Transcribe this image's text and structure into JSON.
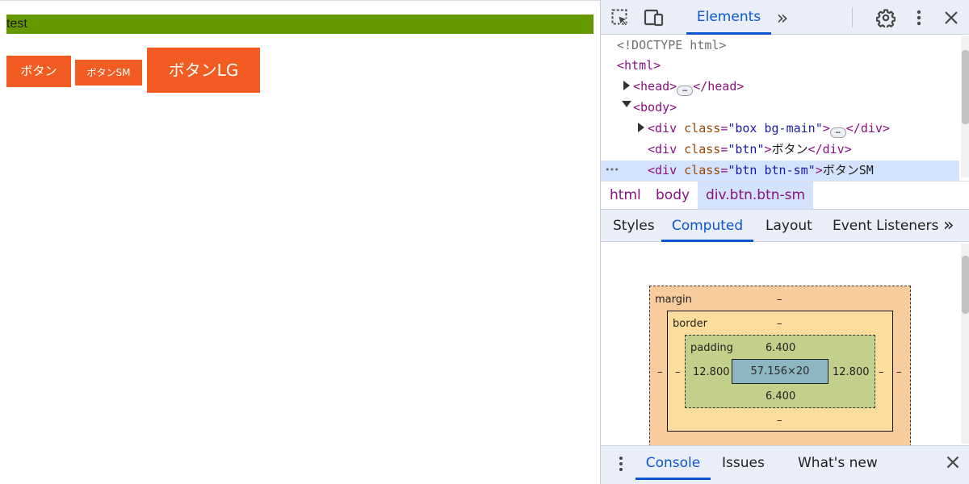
{
  "page": {
    "box_text": "test",
    "buttons": [
      "ボタン",
      "ボタンSM",
      "ボタンLG"
    ],
    "colors": {
      "box": "#669900",
      "button": "#f25c22"
    }
  },
  "devtools": {
    "toolbar": {
      "icons": [
        "inspect-element-icon",
        "device-toolbar-icon",
        "more-tabs-chevron-icon",
        "settings-gear-icon",
        "more-options-kebab-icon",
        "close-icon"
      ],
      "active_tab": "Elements",
      "more_tabs": "»"
    },
    "dom": {
      "doctype": "<!DOCTYPE html>",
      "html_open": "<html>",
      "head_open": "<head>",
      "head_close": "</head>",
      "body_open": "<body>",
      "div_open": "<div",
      "div_close_tag": "</div>",
      "gt": ">",
      "class_attr": "class",
      "eq": "=",
      "box_class": "\"box bg-main\"",
      "btn_class": "\"btn\"",
      "btn_sm_class": "\"btn btn-sm\"",
      "btn_text": "ボタン",
      "btn_sm_text": "ボタンSM",
      "ellipsis": "…",
      "row_menu": "•••"
    },
    "breadcrumbs": [
      "html",
      "body",
      "div.btn.btn-sm"
    ],
    "subtabs": [
      "Styles",
      "Computed",
      "Layout",
      "Event Listeners"
    ],
    "subtabs_more": "»",
    "box_model": {
      "margin_label": "margin",
      "border_label": "border",
      "padding_label": "padding",
      "margin_top": "–",
      "margin_left": "–",
      "margin_right": "–",
      "border_top": "–",
      "border_left": "–",
      "border_right": "–",
      "border_bottom": "–",
      "padding_top": "6.400",
      "padding_bottom": "6.400",
      "padding_left": "12.800",
      "padding_right": "12.800",
      "content": "57.156×20"
    },
    "drawer": {
      "menu_icon": "kebab-icon",
      "tabs": [
        "Console",
        "Issues",
        "What's new"
      ],
      "active_tab": "Console",
      "close_icon": "close-icon"
    }
  }
}
